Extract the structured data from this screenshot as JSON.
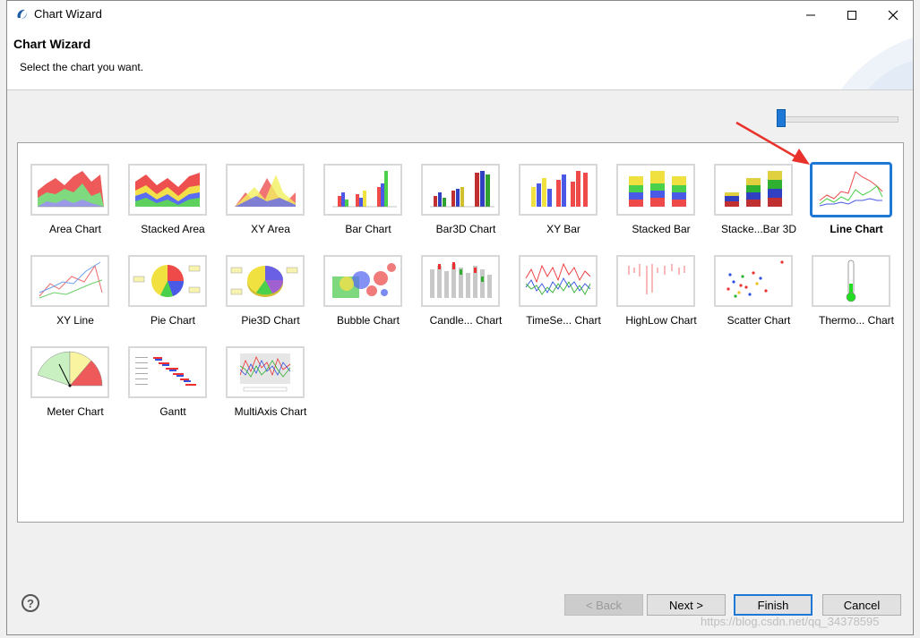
{
  "window": {
    "title": "Chart Wizard",
    "controls": [
      "minimize",
      "maximize",
      "close"
    ]
  },
  "header": {
    "title": "Chart Wizard",
    "message": "Select the chart you want."
  },
  "charts": [
    {
      "label": "Area Chart",
      "icon": "area-chart-icon"
    },
    {
      "label": "Stacked Area",
      "icon": "stacked-area-chart-icon"
    },
    {
      "label": "XY Area",
      "icon": "xy-area-chart-icon"
    },
    {
      "label": "Bar Chart",
      "icon": "bar-chart-icon"
    },
    {
      "label": "Bar3D Chart",
      "icon": "bar3d-chart-icon"
    },
    {
      "label": "XY Bar",
      "icon": "xy-bar-chart-icon"
    },
    {
      "label": "Stacked Bar",
      "icon": "stacked-bar-chart-icon"
    },
    {
      "label": "Stacke...Bar 3D",
      "icon": "stacked-bar3d-chart-icon"
    },
    {
      "label": "Line Chart",
      "icon": "line-chart-icon",
      "selected": true
    },
    {
      "label": "XY Line",
      "icon": "xy-line-chart-icon"
    },
    {
      "label": "Pie Chart",
      "icon": "pie-chart-icon"
    },
    {
      "label": "Pie3D Chart",
      "icon": "pie3d-chart-icon"
    },
    {
      "label": "Bubble Chart",
      "icon": "bubble-chart-icon"
    },
    {
      "label": "Candle... Chart",
      "icon": "candlestick-chart-icon"
    },
    {
      "label": "TimeSe... Chart",
      "icon": "time-series-chart-icon"
    },
    {
      "label": "HighLow Chart",
      "icon": "high-low-chart-icon"
    },
    {
      "label": "Scatter Chart",
      "icon": "scatter-chart-icon"
    },
    {
      "label": "Thermo... Chart",
      "icon": "thermometer-chart-icon"
    },
    {
      "label": "Meter Chart",
      "icon": "meter-chart-icon"
    },
    {
      "label": "Gantt",
      "icon": "gantt-chart-icon"
    },
    {
      "label": "MultiAxis Chart",
      "icon": "multi-axis-chart-icon"
    }
  ],
  "buttons": {
    "back": "< Back",
    "next": "Next >",
    "finish": "Finish",
    "cancel": "Cancel"
  },
  "watermark": "https://blog.csdn.net/qq_34378595",
  "colors": {
    "selection": "#1e78d6",
    "annotation_arrow": "#e8322b"
  }
}
